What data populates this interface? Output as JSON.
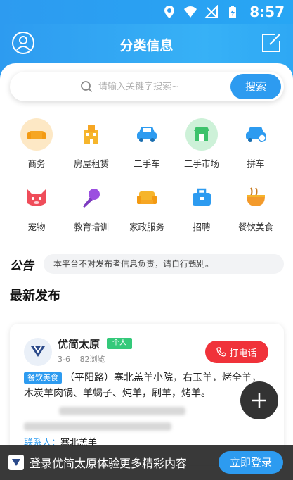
{
  "status_bar": {
    "time": "8:57"
  },
  "header": {
    "title": "分类信息"
  },
  "search": {
    "placeholder": "请输入关键字搜索~",
    "button_label": "搜索"
  },
  "categories": [
    {
      "label": "商务",
      "icon": "sofa-icon",
      "color": "#f6a623"
    },
    {
      "label": "房屋租赁",
      "icon": "building-icon",
      "color": "#f6b52b"
    },
    {
      "label": "二手车",
      "icon": "car-icon",
      "color": "#2d9bf0"
    },
    {
      "label": "二手市场",
      "icon": "market-stall-icon",
      "color": "#3cc26b"
    },
    {
      "label": "拼车",
      "icon": "carpool-icon",
      "color": "#2d9bf0"
    },
    {
      "label": "宠物",
      "icon": "pet-icon",
      "color": "#ef4d5a"
    },
    {
      "label": "教育培训",
      "icon": "microphone-icon",
      "color": "#9b4fe0"
    },
    {
      "label": "家政服务",
      "icon": "sofa-icon",
      "color": "#f6b52b"
    },
    {
      "label": "招聘",
      "icon": "briefcase-icon",
      "color": "#2d9bf0"
    },
    {
      "label": "餐饮美食",
      "icon": "noodle-bowl-icon",
      "color": "#f39a2b"
    }
  ],
  "notice": {
    "title": "公告",
    "text": "本平台不对发布者信息负责，请自行甄别。"
  },
  "latest": {
    "title": "最新发布"
  },
  "post": {
    "publisher": "优简太原",
    "tag": "个人",
    "date": "3-6",
    "views": "82浏览",
    "call_label": "打电话",
    "category_tag": "餐饮美食",
    "description": "（平阳路）塞北羔羊小院，右玉羊，烤全羊，木炭羊肉锅、羊蝎子、炖羊，刷羊，烤羊。",
    "contact_label": "联系人：",
    "contact_name": "塞北羔羊"
  },
  "login_bar": {
    "text": "登录优简太原体验更多精彩内容",
    "button_label": "立即登录"
  },
  "colors": {
    "primary": "#2d9bf0",
    "call": "#f0323a",
    "tag_green": "#34c97a"
  }
}
